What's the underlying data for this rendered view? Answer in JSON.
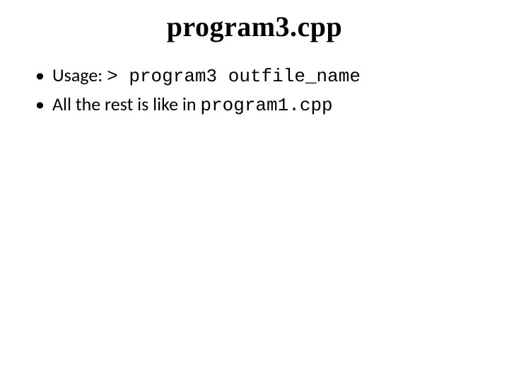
{
  "title": "program3.cpp",
  "bullets": [
    {
      "prefix": "Usage: ",
      "code": "> program3 outfile_name",
      "suffix": ""
    },
    {
      "prefix": "All the rest is like in ",
      "code": "program1.cpp",
      "suffix": ""
    }
  ]
}
